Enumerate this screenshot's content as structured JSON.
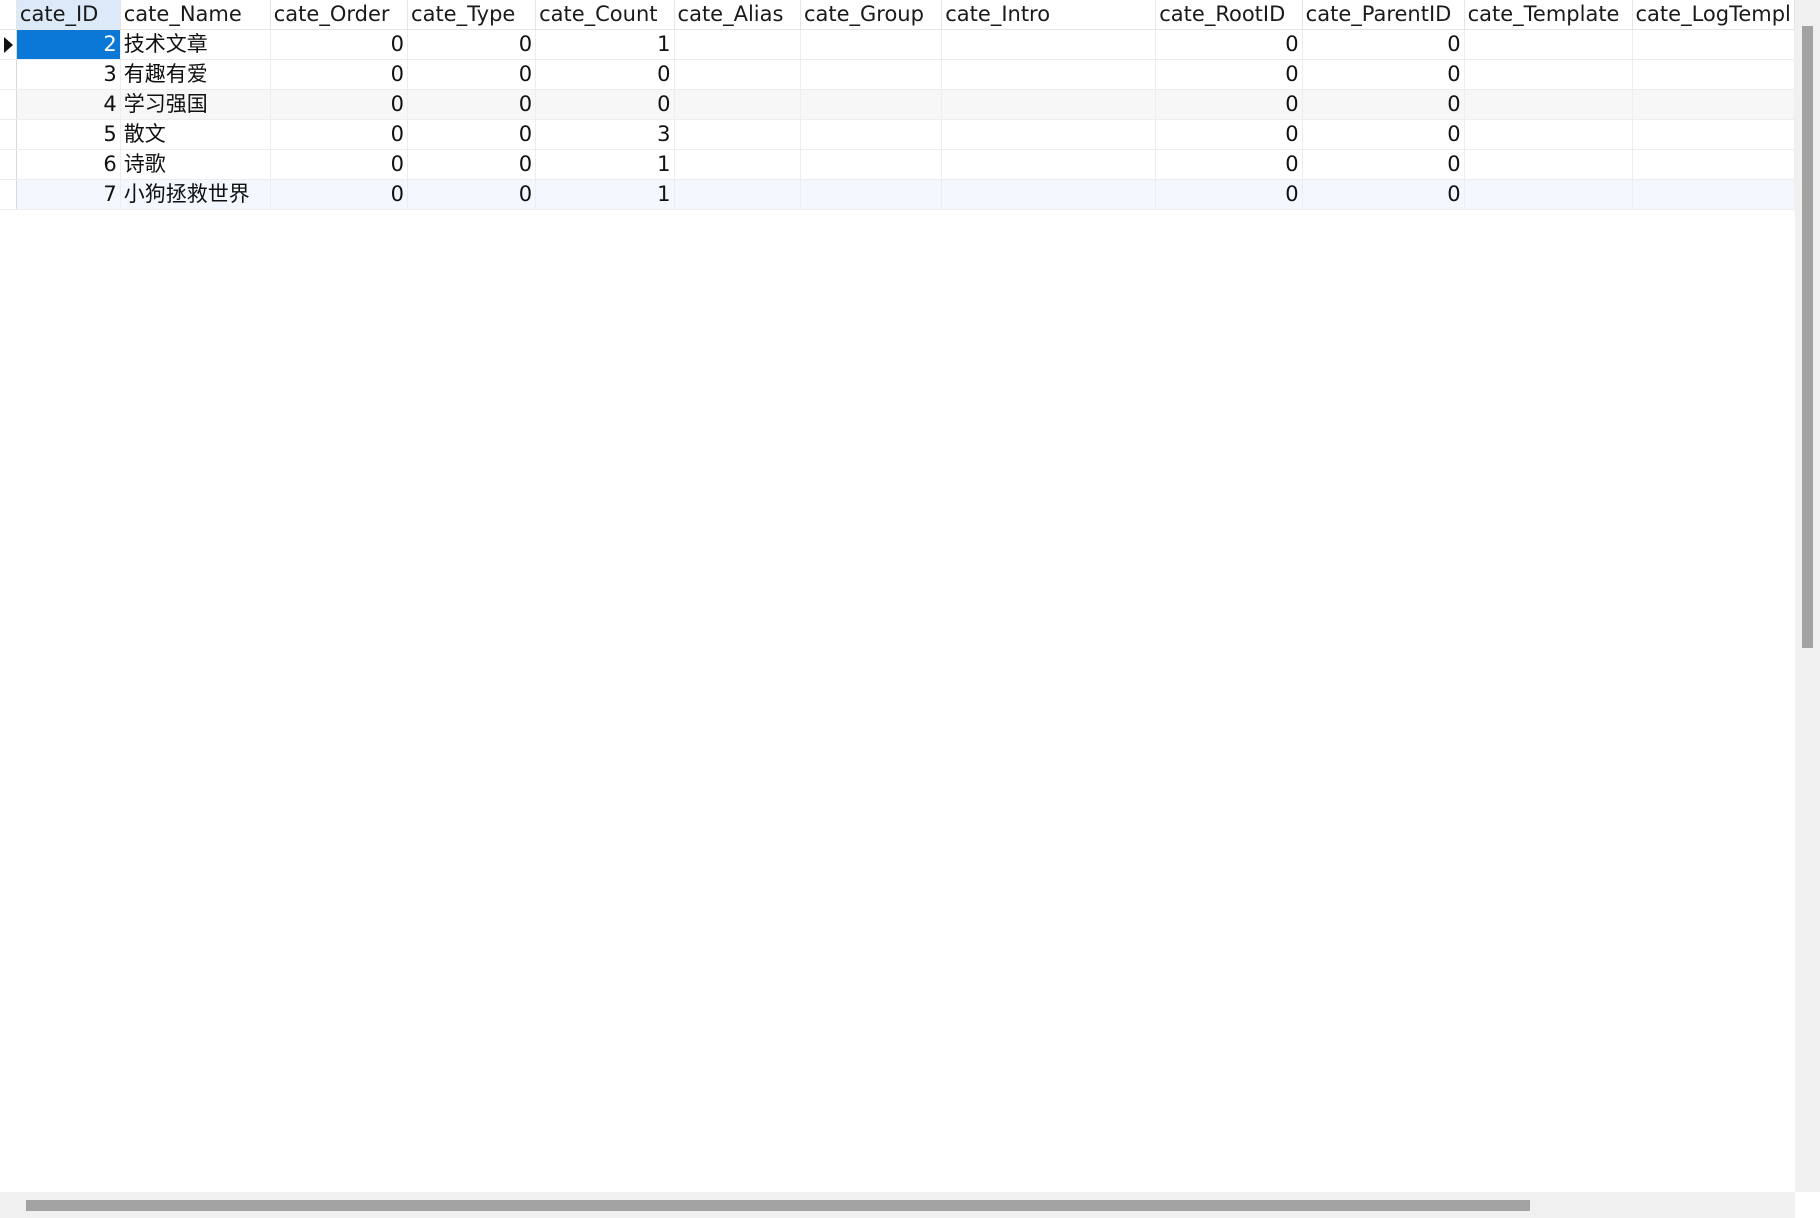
{
  "grid": {
    "columns": [
      {
        "key": "cate_ID",
        "label": "cate_ID",
        "align": "num"
      },
      {
        "key": "cate_Name",
        "label": "cate_Name",
        "align": "txt"
      },
      {
        "key": "cate_Order",
        "label": "cate_Order",
        "align": "num"
      },
      {
        "key": "cate_Type",
        "label": "cate_Type",
        "align": "num"
      },
      {
        "key": "cate_Count",
        "label": "cate_Count",
        "align": "num"
      },
      {
        "key": "cate_Alias",
        "label": "cate_Alias",
        "align": "txt"
      },
      {
        "key": "cate_Group",
        "label": "cate_Group",
        "align": "txt"
      },
      {
        "key": "cate_Intro",
        "label": "cate_Intro",
        "align": "txt"
      },
      {
        "key": "cate_RootID",
        "label": "cate_RootID",
        "align": "num"
      },
      {
        "key": "cate_ParentID",
        "label": "cate_ParentID",
        "align": "num"
      },
      {
        "key": "cate_Template",
        "label": "cate_Template",
        "align": "txt"
      },
      {
        "key": "cate_LogTemplate",
        "label": "cate_LogTempl",
        "align": "txt"
      }
    ],
    "rows": [
      [
        "2",
        "技术文章",
        "0",
        "0",
        "1",
        "",
        "",
        "",
        "0",
        "0",
        "",
        ""
      ],
      [
        "3",
        "有趣有爱",
        "0",
        "0",
        "0",
        "",
        "",
        "",
        "0",
        "0",
        "",
        ""
      ],
      [
        "4",
        "学习强国",
        "0",
        "0",
        "0",
        "",
        "",
        "",
        "0",
        "0",
        "",
        ""
      ],
      [
        "5",
        "散文",
        "0",
        "0",
        "3",
        "",
        "",
        "",
        "0",
        "0",
        "",
        ""
      ],
      [
        "6",
        "诗歌",
        "0",
        "0",
        "1",
        "",
        "",
        "",
        "0",
        "0",
        "",
        ""
      ],
      [
        "7",
        "小狗拯救世界",
        "0",
        "0",
        "1",
        "",
        "",
        "",
        "0",
        "0",
        "",
        ""
      ]
    ],
    "current_row_index": 0,
    "selected_column_key": "cate_ID",
    "colors": {
      "selection": "#0a78d7",
      "header_highlight": "#dbe9f8",
      "scroll_thumb": "#a3a3a3"
    }
  }
}
